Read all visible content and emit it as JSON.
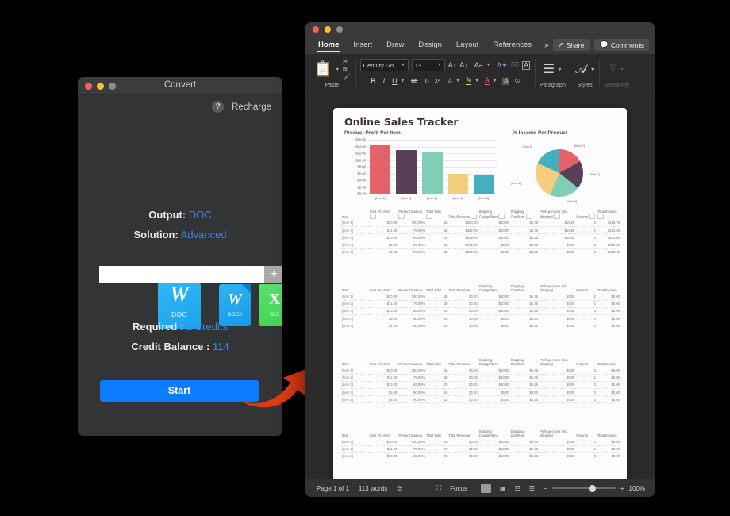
{
  "convert_window": {
    "title": "Convert",
    "help_icon_label": "?",
    "recharge_label": "Recharge",
    "output_key": "Output:",
    "output_value": "DOC",
    "solution_key": "Solution:",
    "solution_value": "Advanced",
    "file_types": [
      {
        "glyph": "W",
        "caption": "DOC",
        "selected": true
      },
      {
        "glyph": "W",
        "caption": "DOCX",
        "selected": false
      },
      {
        "glyph": "X",
        "caption": "XLS",
        "selected": false
      }
    ],
    "path_input_value": "",
    "path_input_placeholder": "",
    "add_button_label": "+",
    "required_key": "Required :",
    "required_value": "1 Credits",
    "balance_key": "Credit Balance :",
    "balance_value": "114",
    "start_button_label": "Start",
    "accent_color": "#2b8cf5",
    "start_button_color": "#0b7cfb",
    "arrow_color": "#e03a12"
  },
  "word_window": {
    "tabs": [
      {
        "label": "Home",
        "active": true
      },
      {
        "label": "Insert",
        "active": false
      },
      {
        "label": "Draw",
        "active": false
      },
      {
        "label": "Design",
        "active": false
      },
      {
        "label": "Layout",
        "active": false
      },
      {
        "label": "References",
        "active": false
      }
    ],
    "tab_overflow": "»",
    "share_label": "Share",
    "comments_label": "Comments",
    "ribbon": {
      "paste_label": "Paste",
      "font_name": "Century Go...",
      "font_size": "13",
      "paragraph_label": "Paragraph",
      "styles_label": "Styles",
      "sensitivity_label": "Sensitivity"
    },
    "status_bar": {
      "page_label": "Page 1 of 1",
      "word_count": "113 words",
      "focus_label": "Focus",
      "zoom_level": "100%",
      "zoom_minus": "−",
      "zoom_plus": "+"
    }
  },
  "document": {
    "title": "Online Sales Tracker",
    "table_headers": [
      "Item",
      "Cost Per Item",
      "Percent Markup",
      "Total Sold",
      "Total Revenue",
      "Shipping Charge/Item",
      "Shipping Cost/Item",
      "Profit per Item (incl. shipping)",
      "Returns",
      "Total Income"
    ],
    "tables": [
      {
        "rows": [
          [
            "[Item 1]",
            "$10.00",
            "100.00%",
            "15",
            "$300.00",
            "$10.00",
            "$5.75",
            "$14.25",
            "2",
            "$196.75"
          ],
          [
            "[Item 2]",
            "$11.50",
            "75.00%",
            "18",
            "$362.25",
            "$10.00",
            "$5.75",
            "$12.88",
            "1",
            "$224.63"
          ],
          [
            "[Item 3]",
            "$13.00",
            "65.00%",
            "20",
            "$429.00",
            "$10.00",
            "$6.25",
            "$12.20",
            "0",
            "$244.00"
          ],
          [
            "[Item 4]",
            "$5.00",
            "90.00%",
            "50",
            "$475.00",
            "$5.00",
            "$3.50",
            "$6.00",
            "0",
            "$300.00"
          ],
          [
            "[Item 5]",
            "$4.00",
            "90.00%",
            "42",
            "$319.20",
            "$5.00",
            "$3.25",
            "$5.35",
            "3",
            "$218.40"
          ]
        ]
      },
      {
        "rows": [
          [
            "[Item 1]",
            "$10.00",
            "100.00%",
            "15",
            "$0.00",
            "$10.00",
            "$5.75",
            "$0.00",
            "2",
            "$0.00"
          ],
          [
            "[Item 2]",
            "$11.50",
            "75.00%",
            "18",
            "$0.00",
            "$10.00",
            "$5.75",
            "$0.00",
            "1",
            "$0.00"
          ],
          [
            "[Item 3]",
            "$13.00",
            "65.00%",
            "20",
            "$0.00",
            "$10.00",
            "$6.25",
            "$0.00",
            "0",
            "$0.00"
          ],
          [
            "[Item 4]",
            "$5.00",
            "90.00%",
            "50",
            "$0.00",
            "$5.00",
            "$3.50",
            "$0.00",
            "0",
            "$0.00"
          ],
          [
            "[Item 5]",
            "$4.00",
            "90.00%",
            "42",
            "$0.00",
            "$5.00",
            "$3.25",
            "$0.00",
            "3",
            "$0.00"
          ]
        ]
      },
      {
        "rows": [
          [
            "[Item 1]",
            "$10.00",
            "100.00%",
            "15",
            "$0.00",
            "$10.00",
            "$5.75",
            "$0.00",
            "2",
            "$0.00"
          ],
          [
            "[Item 2]",
            "$11.50",
            "75.00%",
            "18",
            "$0.00",
            "$10.00",
            "$5.75",
            "$0.00",
            "1",
            "$0.00"
          ],
          [
            "[Item 3]",
            "$13.00",
            "65.00%",
            "20",
            "$0.00",
            "$10.00",
            "$6.25",
            "$0.00",
            "0",
            "$0.00"
          ],
          [
            "[Item 4]",
            "$5.00",
            "90.00%",
            "50",
            "$0.00",
            "$5.00",
            "$3.50",
            "$0.00",
            "0",
            "$0.00"
          ],
          [
            "[Item 5]",
            "$4.00",
            "90.00%",
            "42",
            "$0.00",
            "$5.00",
            "$3.25",
            "$0.00",
            "3",
            "$0.00"
          ]
        ]
      },
      {
        "rows": [
          [
            "[Item 1]",
            "$10.00",
            "100.00%",
            "15",
            "$0.00",
            "$10.00",
            "$5.75",
            "$0.00",
            "2",
            "$0.00"
          ],
          [
            "[Item 2]",
            "$11.50",
            "75.00%",
            "18",
            "$0.00",
            "$10.00",
            "$5.75",
            "$0.00",
            "1",
            "$0.00"
          ],
          [
            "[Item 3]",
            "$13.00",
            "65.00%",
            "20",
            "$0.00",
            "$10.00",
            "$6.25",
            "$0.00",
            "0",
            "$0.00"
          ]
        ]
      }
    ]
  },
  "chart_data": [
    {
      "type": "bar",
      "title": "Product Profit Per Item",
      "categories": [
        "[Item 1]",
        "[Item 2]",
        "[Item 3]",
        "[Item 4]",
        "[Item 5]"
      ],
      "values": [
        14.25,
        12.88,
        12.2,
        6.0,
        5.35
      ],
      "colors": [
        "#e2636a",
        "#584058",
        "#7ecfb6",
        "#f4ce7d",
        "#44b0bf"
      ],
      "xlabel": "",
      "ylabel": "",
      "ylim": [
        0,
        16
      ],
      "ytick_labels": [
        "$0.00",
        "$2.00",
        "$4.00",
        "$6.00",
        "$8.00",
        "$10.00",
        "$12.00",
        "$14.00",
        "$16.00"
      ],
      "grid": true,
      "legend": "none"
    },
    {
      "type": "pie",
      "title": "% Income Per Product",
      "categories": [
        "[Item 1]",
        "[Item 2]",
        "[Item 3]",
        "[Item 4]",
        "[Item 5]"
      ],
      "values": [
        16.7,
        19.0,
        20.7,
        25.4,
        18.2
      ],
      "colors": [
        "#e2636a",
        "#584058",
        "#7ecfb6",
        "#f4ce7d",
        "#44b0bf"
      ],
      "legend": "labels"
    }
  ]
}
